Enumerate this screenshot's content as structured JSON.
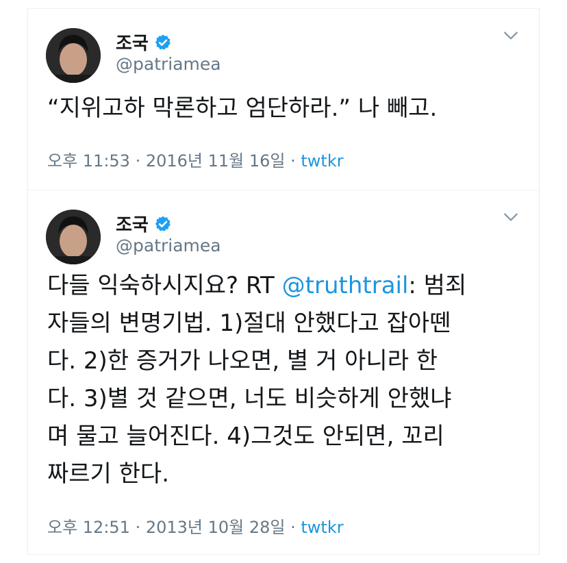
{
  "tweets": [
    {
      "name": "조국",
      "handle": "@patriamea",
      "text": "“지위고하 막론하고 엄단하라.” 나 빼고.",
      "time": "오후 11:53 · 2016년 11월 16일",
      "sep": " · ",
      "source": "twtkr"
    },
    {
      "name": "조국",
      "handle": "@patriamea",
      "text_before": "다들 익숙하시지요? RT ",
      "mention": "@truthtrail",
      "text_after": ": 범죄\n자들의 변명기법. 1)절대 안했다고 잡아뗀\n다. 2)한 증거가 나오면, 별 거 아니라 한\n다. 3)별 것 같으면, 너도 비슷하게 안했냐\n며 물고 늘어진다. 4)그것도 안되면, 꼬리\n짜르기 한다.",
      "time": "오후 12:51 · 2013년 10월 28일",
      "sep": " · ",
      "source": "twtkr"
    }
  ],
  "icons": {
    "verified": "verified-badge-icon",
    "menu": "chevron-down-icon",
    "avatar": "profile-photo"
  },
  "colors": {
    "link": "#1b95e0",
    "verified": "#1da1f2",
    "muted": "#657786"
  }
}
